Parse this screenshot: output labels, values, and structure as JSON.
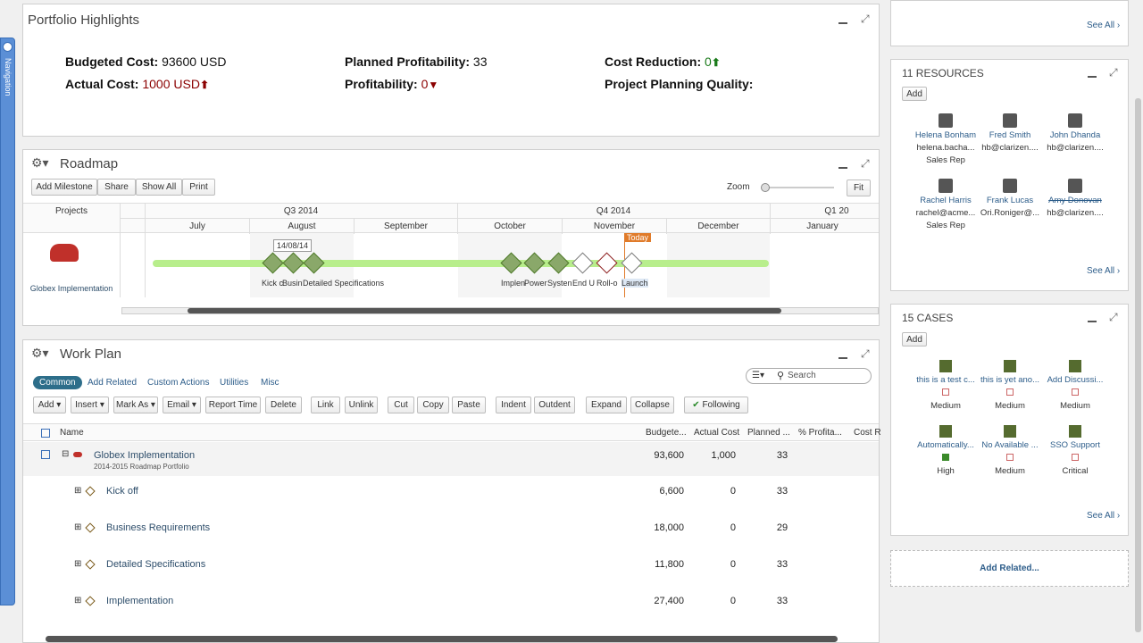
{
  "nav": {
    "label": "Navigation"
  },
  "highlights": {
    "title": "Portfolio Highlights",
    "budgeted_label": "Budgeted Cost:",
    "budgeted_value": "93600 USD",
    "actual_label": "Actual Cost:",
    "actual_value": "1000 USD",
    "planned_prof_label": "Planned Profitability:",
    "planned_prof_value": "33",
    "prof_label": "Profitability:",
    "prof_value": "0",
    "cost_red_label": "Cost Reduction:",
    "cost_red_value": "0",
    "quality_label": "Project Planning Quality:"
  },
  "roadmap": {
    "title": "Roadmap",
    "buttons": [
      "Add Milestone",
      "Share",
      "Show All",
      "Print"
    ],
    "zoom_label": "Zoom",
    "fit_label": "Fit",
    "projects_header": "Projects",
    "quarters": [
      "Q3 2014",
      "Q4 2014",
      "Q1 20"
    ],
    "months": [
      "July",
      "August",
      "September",
      "October",
      "November",
      "December",
      "January"
    ],
    "date_tag": "14/08/14",
    "today_tag": "Today",
    "project_name": "Globex Implementation",
    "milestone_labels": [
      "Kick c",
      "Busin",
      "Detailed Specifications",
      "Implen",
      "Power",
      "Systen",
      "End U",
      "Roll-o",
      "Launch"
    ]
  },
  "workplan": {
    "title": "Work Plan",
    "tabs": [
      "Common",
      "Add Related",
      "Custom Actions",
      "Utilities",
      "Misc"
    ],
    "search_placeholder": "Search",
    "toolbar": [
      "Add",
      "Insert",
      "Mark As",
      "Email",
      "Report Time",
      "Delete",
      "Link",
      "Unlink",
      "Cut",
      "Copy",
      "Paste",
      "Indent",
      "Outdent",
      "Expand",
      "Collapse",
      "Following"
    ],
    "columns": [
      "Name",
      "Budgete...",
      "Actual Cost",
      "Planned ...",
      "% Profita...",
      "Cost R"
    ],
    "rows": [
      {
        "name": "Globex Implementation",
        "sub": "2014-2015 Roadmap Portfolio",
        "budget": "93,600",
        "actual": "1,000",
        "planned": "33"
      },
      {
        "name": "Kick off",
        "budget": "6,600",
        "actual": "0",
        "planned": "33"
      },
      {
        "name": "Business Requirements",
        "budget": "18,000",
        "actual": "0",
        "planned": "29"
      },
      {
        "name": "Detailed Specifications",
        "budget": "11,800",
        "actual": "0",
        "planned": "33"
      },
      {
        "name": "Implementation",
        "budget": "27,400",
        "actual": "0",
        "planned": "33"
      }
    ]
  },
  "top_right": {
    "see_all": "See All"
  },
  "resources": {
    "title": "11 RESOURCES",
    "add": "Add",
    "see_all": "See All",
    "items": [
      {
        "name": "Helena Bonham",
        "email": "helena.bacha...",
        "role": "Sales Rep"
      },
      {
        "name": "Fred Smith",
        "email": "hb@clarizen....",
        "role": ""
      },
      {
        "name": "John Dhanda",
        "email": "hb@clarizen....",
        "role": ""
      },
      {
        "name": "Rachel Harris",
        "email": "rachel@acme...",
        "role": "Sales Rep"
      },
      {
        "name": "Frank Lucas",
        "email": "Ori.Roniger@...",
        "role": ""
      },
      {
        "name": "Amy Donovan",
        "email": "hb@clarizen....",
        "role": ""
      }
    ]
  },
  "cases": {
    "title": "15 CASES",
    "add": "Add",
    "see_all": "See All",
    "items": [
      {
        "name": "this is a test c...",
        "priority": "Medium"
      },
      {
        "name": "this is yet ano...",
        "priority": "Medium"
      },
      {
        "name": "Add Discussi...",
        "priority": "Medium"
      },
      {
        "name": "Automatically...",
        "priority": "High"
      },
      {
        "name": "No Available ...",
        "priority": "Medium"
      },
      {
        "name": "SSO Support",
        "priority": "Critical"
      }
    ]
  },
  "add_related": {
    "label": "Add Related..."
  }
}
